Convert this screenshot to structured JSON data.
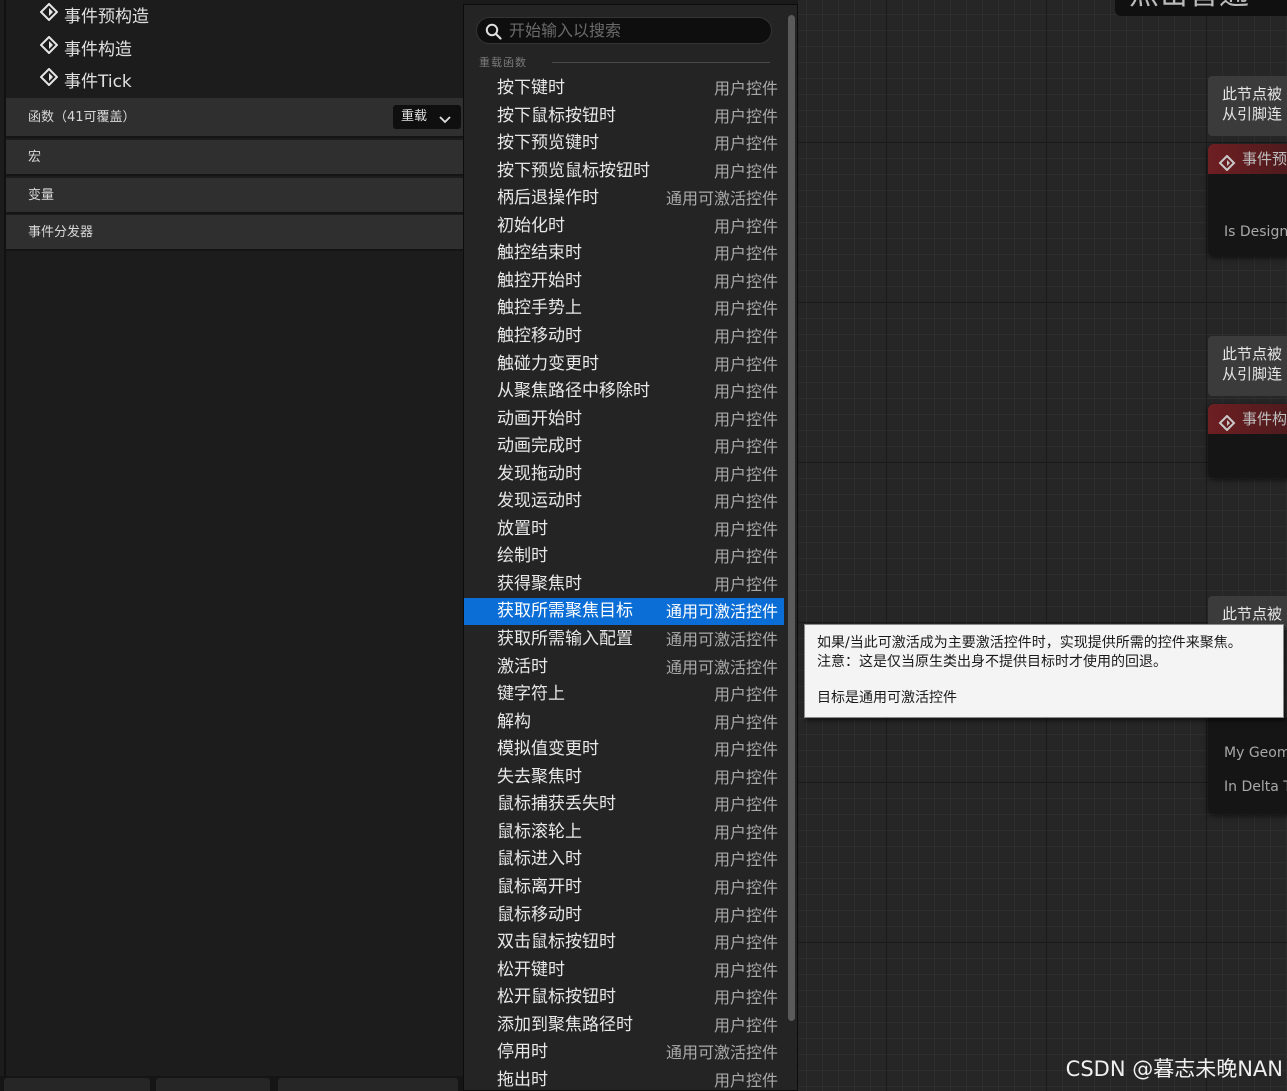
{
  "graph": {
    "title": "点击普通",
    "comments": [
      {
        "line1": "此节点被",
        "line2": "从引脚连"
      },
      {
        "line1": "此节点被",
        "line2": "从引脚连"
      },
      {
        "line1": "此节点被",
        "line2": ""
      }
    ],
    "nodes": [
      {
        "title": "事件预",
        "pin": "Is Design"
      },
      {
        "title": "事件构",
        "pin": ""
      }
    ],
    "tick_pins": [
      "My Geom",
      "In Delta T"
    ]
  },
  "left_panel": {
    "events": [
      "事件预构造",
      "事件构造",
      "事件Tick"
    ],
    "functions_label": "函数（41可覆盖）",
    "override_label": "重载",
    "macros_label": "宏",
    "variables_label": "变量",
    "dispatchers_label": "事件分发器"
  },
  "menu": {
    "search_placeholder": "开始输入以搜索",
    "category": "重载函数",
    "items": [
      {
        "name": "按下键时",
        "target": "用户控件"
      },
      {
        "name": "按下鼠标按钮时",
        "target": "用户控件"
      },
      {
        "name": "按下预览键时",
        "target": "用户控件"
      },
      {
        "name": "按下预览鼠标按钮时",
        "target": "用户控件"
      },
      {
        "name": "柄后退操作时",
        "target": "通用可激活控件"
      },
      {
        "name": "初始化时",
        "target": "用户控件"
      },
      {
        "name": "触控结束时",
        "target": "用户控件"
      },
      {
        "name": "触控开始时",
        "target": "用户控件"
      },
      {
        "name": "触控手势上",
        "target": "用户控件"
      },
      {
        "name": "触控移动时",
        "target": "用户控件"
      },
      {
        "name": "触碰力变更时",
        "target": "用户控件"
      },
      {
        "name": "从聚焦路径中移除时",
        "target": "用户控件"
      },
      {
        "name": "动画开始时",
        "target": "用户控件"
      },
      {
        "name": "动画完成时",
        "target": "用户控件"
      },
      {
        "name": "发现拖动时",
        "target": "用户控件"
      },
      {
        "name": "发现运动时",
        "target": "用户控件"
      },
      {
        "name": "放置时",
        "target": "用户控件"
      },
      {
        "name": "绘制时",
        "target": "用户控件"
      },
      {
        "name": "获得聚焦时",
        "target": "用户控件"
      },
      {
        "name": "获取所需聚焦目标",
        "target": "通用可激活控件"
      },
      {
        "name": "获取所需输入配置",
        "target": "通用可激活控件"
      },
      {
        "name": "激活时",
        "target": "通用可激活控件"
      },
      {
        "name": "键字符上",
        "target": "用户控件"
      },
      {
        "name": "解构",
        "target": "用户控件"
      },
      {
        "name": "模拟值变更时",
        "target": "用户控件"
      },
      {
        "name": "失去聚焦时",
        "target": "用户控件"
      },
      {
        "name": "鼠标捕获丢失时",
        "target": "用户控件"
      },
      {
        "name": "鼠标滚轮上",
        "target": "用户控件"
      },
      {
        "name": "鼠标进入时",
        "target": "用户控件"
      },
      {
        "name": "鼠标离开时",
        "target": "用户控件"
      },
      {
        "name": "鼠标移动时",
        "target": "用户控件"
      },
      {
        "name": "双击鼠标按钮时",
        "target": "用户控件"
      },
      {
        "name": "松开键时",
        "target": "用户控件"
      },
      {
        "name": "松开鼠标按钮时",
        "target": "用户控件"
      },
      {
        "name": "添加到聚焦路径时",
        "target": "用户控件"
      },
      {
        "name": "停用时",
        "target": "通用可激活控件"
      },
      {
        "name": "拖出时",
        "target": "用户控件"
      }
    ],
    "selected_index": 19
  },
  "tooltip": {
    "line1": "如果/当此可激活成为主要激活控件时，实现提供所需的控件来聚焦。",
    "line2": "注意：这是仅当原生类出身不提供目标时才使用的回退。",
    "line3": "目标是通用可激活控件"
  },
  "watermark": "CSDN @暮志未晚NAN",
  "colors": {
    "selection": "#0b6ed6",
    "event_node_header": "#6e1f22",
    "tooltip_bg": "#f4f4f4"
  }
}
